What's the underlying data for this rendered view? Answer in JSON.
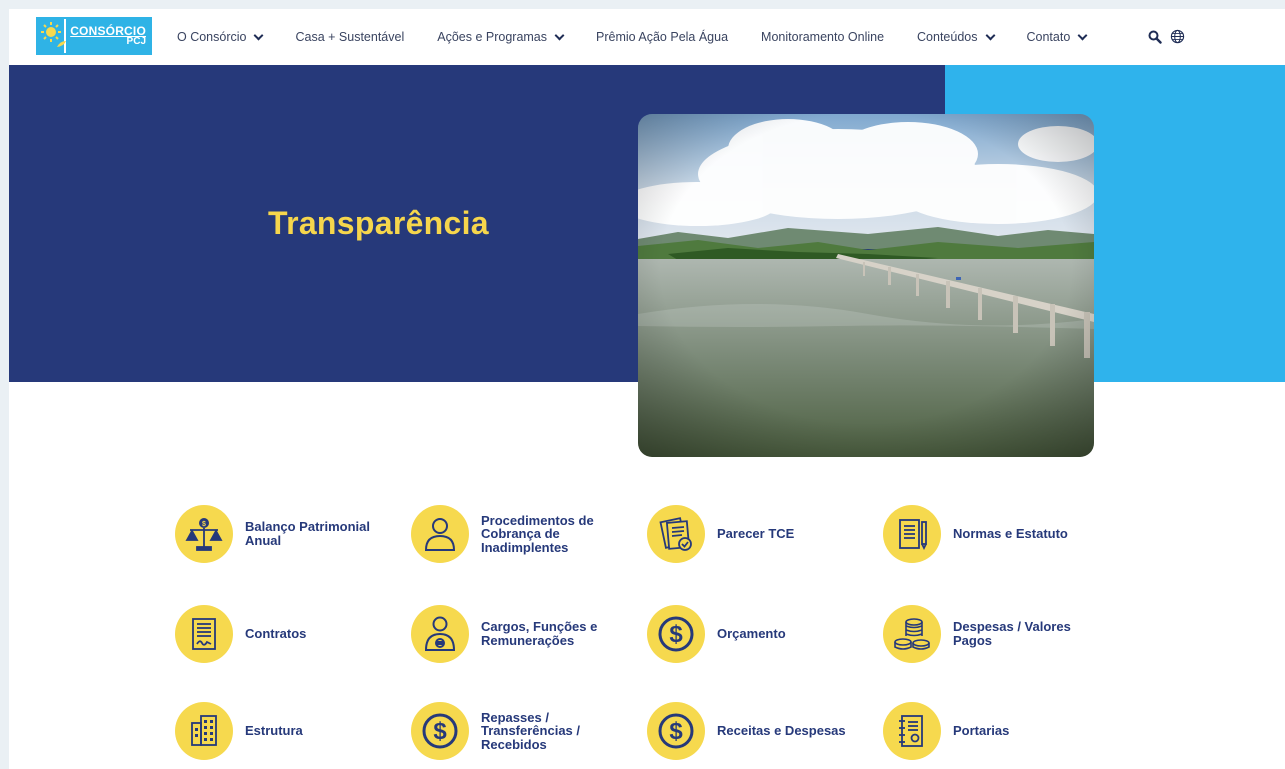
{
  "logo": {
    "line1": "CONSÓRCIO",
    "line2": "PCJ"
  },
  "nav": {
    "items": [
      {
        "label": "O Consórcio",
        "dropdown": true
      },
      {
        "label": "Casa + Sustentável",
        "dropdown": false
      },
      {
        "label": "Ações e Programas",
        "dropdown": true
      },
      {
        "label": "Prêmio Ação Pela Água",
        "dropdown": false
      },
      {
        "label": "Monitoramento Online",
        "dropdown": false
      },
      {
        "label": "Conteúdos",
        "dropdown": true
      },
      {
        "label": "Contato",
        "dropdown": true
      }
    ],
    "icons": [
      "search-icon",
      "globe-icon"
    ]
  },
  "hero": {
    "title": "Transparência"
  },
  "links": [
    {
      "label": "Balanço Patrimonial Anual",
      "icon": "scale-icon"
    },
    {
      "label": "Procedimentos de Cobrança de Inadimplentes",
      "icon": "person-icon"
    },
    {
      "label": "Parecer TCE",
      "icon": "document-check-icon"
    },
    {
      "label": "Normas e Estatuto",
      "icon": "document-pen-icon"
    },
    {
      "label": "Contratos",
      "icon": "contract-icon"
    },
    {
      "label": "Cargos, Funções e Remunerações",
      "icon": "person-badge-icon"
    },
    {
      "label": "Orçamento",
      "icon": "dollar-icon"
    },
    {
      "label": "Despesas / Valores Pagos",
      "icon": "coins-icon"
    },
    {
      "label": "Estrutura",
      "icon": "building-icon"
    },
    {
      "label": "Repasses / Transferências / Recebidos",
      "icon": "dollar-icon"
    },
    {
      "label": "Receitas e Despesas",
      "icon": "dollar-icon"
    },
    {
      "label": "Portarias",
      "icon": "binder-icon"
    }
  ],
  "colors": {
    "navy": "#26397a",
    "cyan": "#2fb3ec",
    "yellow": "#f6d94e",
    "title_yellow": "#f6d64c"
  }
}
